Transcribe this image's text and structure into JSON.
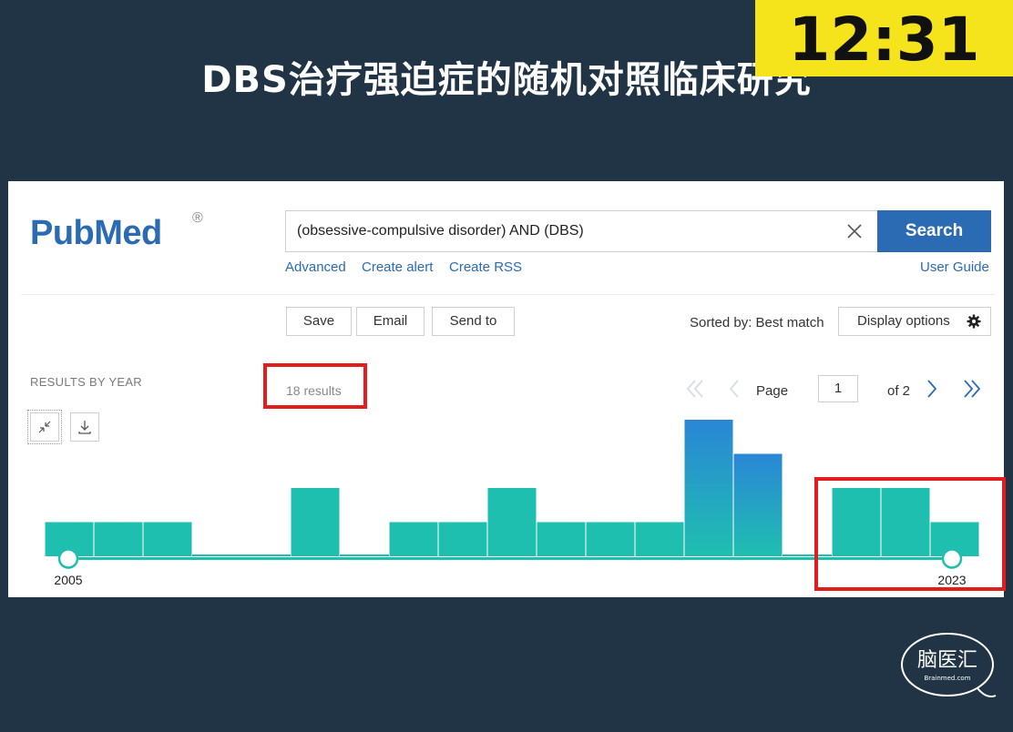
{
  "slide": {
    "title": "DBS治疗强迫症的随机对照临床研究",
    "timer": "12:31",
    "watermark_text": "脑医汇",
    "watermark_sub": "Brainmed.com"
  },
  "pubmed": {
    "logo_text": "PubMed",
    "logo_mark": "®",
    "search": {
      "value": "(obsessive-compulsive disorder) AND (DBS)",
      "button": "Search"
    },
    "links": {
      "advanced": "Advanced",
      "create_alert": "Create alert",
      "create_rss": "Create RSS",
      "user_guide": "User Guide"
    },
    "actions": {
      "save": "Save",
      "email": "Email",
      "send_to": "Send to"
    },
    "sorted_by": "Sorted by: Best match",
    "display_options": "Display options",
    "results_by_year_label": "RESULTS BY YEAR",
    "results_count": "18 results",
    "pagination": {
      "page_label": "Page",
      "current_page": "1",
      "of_label": "of 2"
    }
  },
  "chart_data": {
    "type": "bar",
    "title": "RESULTS BY YEAR",
    "categories": [
      "2005",
      "2006",
      "2007",
      "2008",
      "2009",
      "2010",
      "2011",
      "2012",
      "2013",
      "2014",
      "2015",
      "2016",
      "2017",
      "2018",
      "2019",
      "2020",
      "2021",
      "2022",
      "2023"
    ],
    "values": [
      1,
      1,
      1,
      0,
      0,
      2,
      0,
      1,
      1,
      2,
      1,
      1,
      1,
      4,
      3,
      0,
      2,
      2,
      1
    ],
    "range_start_label": "2005",
    "range_end_label": "2023",
    "colors": {
      "bar": "#1fbfb0",
      "bar_peak_top": "#2a86d6",
      "slider": "#1fbfb0"
    },
    "highlight_years": [
      "2021",
      "2022",
      "2023"
    ]
  },
  "colors": {
    "background": "#213445",
    "pubmed_blue": "#2a6bb4",
    "highlight_red": "#e21d1d",
    "timer_bg": "#f5e41c"
  }
}
